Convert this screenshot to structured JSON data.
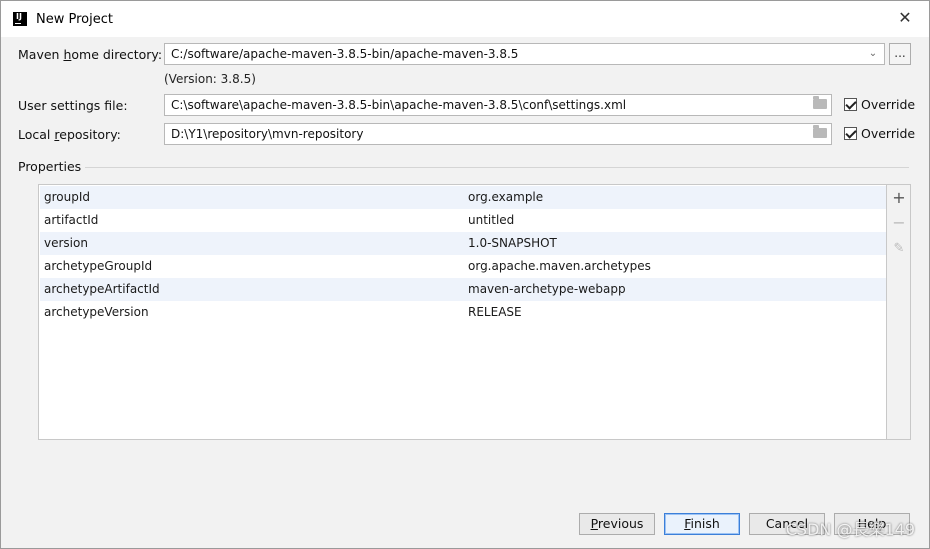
{
  "window": {
    "title": "New Project"
  },
  "maven": {
    "home_label": "Maven home directory:",
    "home_value": "C:/software/apache-maven-3.8.5-bin/apache-maven-3.8.5",
    "browse_label": "...",
    "version_note": "(Version: 3.8.5)",
    "settings_label": "User settings file:",
    "settings_value": "C:\\software\\apache-maven-3.8.5-bin\\apache-maven-3.8.5\\conf\\settings.xml",
    "settings_override_label": "Override",
    "repo_label": "Local repository:",
    "repo_value": "D:\\Y1\\repository\\mvn-repository",
    "repo_override_label": "Override"
  },
  "properties": {
    "title": "Properties",
    "rows": [
      {
        "key": "groupId",
        "value": "org.example"
      },
      {
        "key": "artifactId",
        "value": "untitled"
      },
      {
        "key": "version",
        "value": "1.0-SNAPSHOT"
      },
      {
        "key": "archetypeGroupId",
        "value": "org.apache.maven.archetypes"
      },
      {
        "key": "archetypeArtifactId",
        "value": "maven-archetype-webapp"
      },
      {
        "key": "archetypeVersion",
        "value": "RELEASE"
      }
    ],
    "tools": {
      "add_icon": "plus-icon",
      "remove_icon": "minus-icon",
      "edit_icon": "pencil-icon"
    }
  },
  "buttons": {
    "previous": "Previous",
    "finish": "Finish",
    "cancel": "Cancel",
    "help": "Help"
  },
  "watermark": "CSDN @長樂149",
  "colors": {
    "selection_row": "#eef3fb",
    "default_button_border": "#3c7fd8"
  }
}
